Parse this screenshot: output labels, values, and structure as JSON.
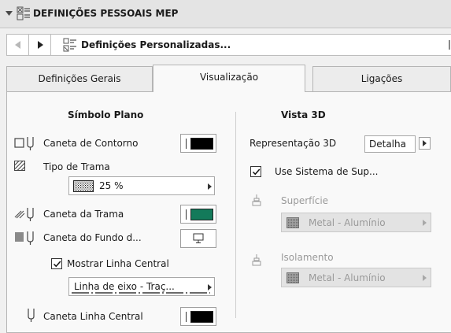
{
  "header": {
    "title": "DEFINIÇÕES PESSOAIS MEP"
  },
  "nav": {
    "label": "Definições Personalizadas..."
  },
  "tabs": [
    {
      "label": "Definições Gerais",
      "active": false
    },
    {
      "label": "Visualização",
      "active": true
    },
    {
      "label": "Ligações",
      "active": false
    }
  ],
  "plan": {
    "heading": "Símbolo Plano",
    "contour_pen_label": "Caneta de Contorno",
    "contour_pen_color": "#000000",
    "hatch_type_label": "Tipo de Trama",
    "hatch_value": "25 %",
    "hatch_pen_label": "Caneta da Trama",
    "hatch_pen_color": "#137a5a",
    "bg_pen_label": "Caneta do Fundo d...",
    "show_centerline_label": "Mostrar Linha Central",
    "show_centerline_checked": true,
    "linetype_value": "Linha de eixo - Traç...",
    "centerline_pen_label": "Caneta Linha Central",
    "centerline_pen_color": "#000000"
  },
  "view3d": {
    "heading": "Vista 3D",
    "representation_label": "Representação 3D",
    "representation_value": "Detalha",
    "use_support_label": "Use Sistema de Sup...",
    "use_support_checked": true,
    "surface_label": "Superfície",
    "surface_value": "Metal - Alumínio",
    "insulation_label": "Isolamento",
    "insulation_value": "Metal - Alumínio"
  },
  "colors": {
    "accent_green": "#137a5a",
    "disabled_text": "#9a9a9a"
  }
}
